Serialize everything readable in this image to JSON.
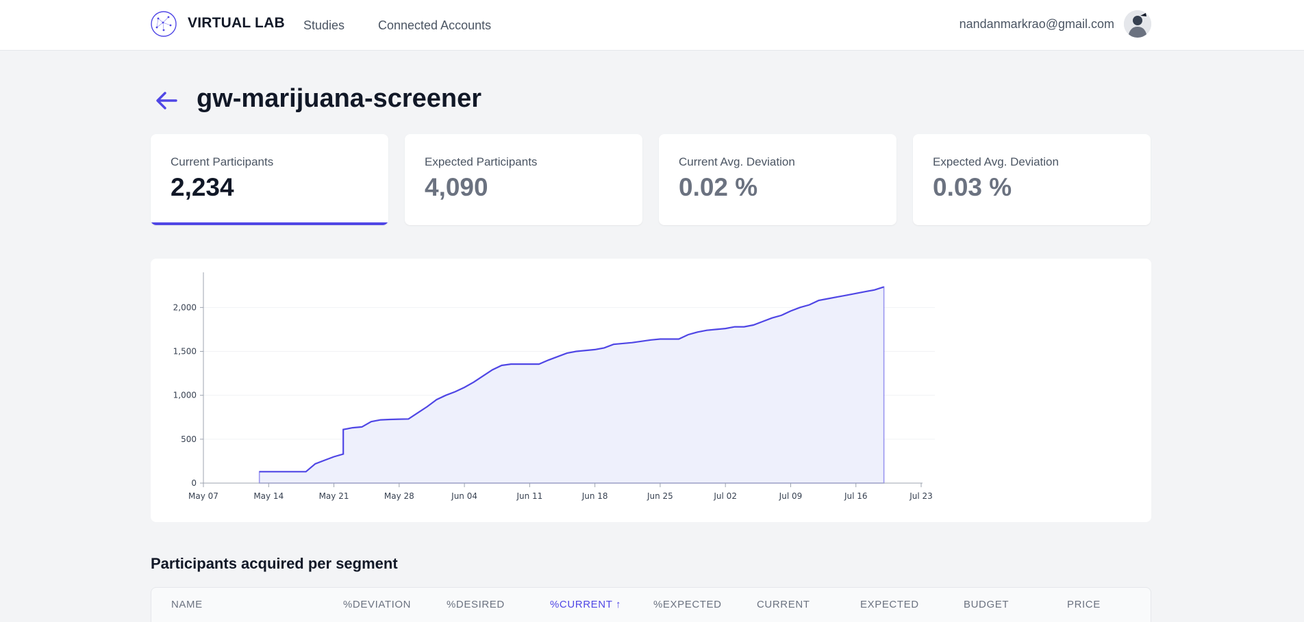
{
  "nav": {
    "brand": "VIRTUAL LAB",
    "links": [
      "Studies",
      "Connected Accounts"
    ],
    "user_email": "nandanmarkrao@gmail.com"
  },
  "page": {
    "title": "gw-marijuana-screener"
  },
  "stats": [
    {
      "label": "Current Participants",
      "value": "2,234"
    },
    {
      "label": "Expected Participants",
      "value": "4,090"
    },
    {
      "label": "Current Avg. Deviation",
      "value": "0.02 %"
    },
    {
      "label": "Expected Avg. Deviation",
      "value": "0.03 %"
    }
  ],
  "colors": {
    "accent": "#4f46e5",
    "area_fill": "#eef0fc",
    "background": "#f3f4f6"
  },
  "chart_data": {
    "type": "area",
    "title": "",
    "xlabel": "",
    "ylabel": "",
    "ylim": [
      0,
      2400
    ],
    "xlim": [
      "2023-05-07",
      "2023-07-23"
    ],
    "y_ticks": [
      "0",
      "500",
      "1,000",
      "1,500",
      "2,000"
    ],
    "y_tick_values": [
      0,
      500,
      1000,
      1500,
      2000
    ],
    "x_ticks": [
      "May 07",
      "May 14",
      "May 21",
      "May 28",
      "Jun 04",
      "Jun 11",
      "Jun 18",
      "Jun 25",
      "Jul 02",
      "Jul 09",
      "Jul 16",
      "Jul 23"
    ],
    "x_tick_dates": [
      "2023-05-07",
      "2023-05-14",
      "2023-05-21",
      "2023-05-28",
      "2023-06-04",
      "2023-06-11",
      "2023-06-18",
      "2023-06-25",
      "2023-07-02",
      "2023-07-09",
      "2023-07-16",
      "2023-07-23"
    ],
    "grid": "horizontal",
    "series": [
      {
        "x": [
          "2023-05-13",
          "2023-05-18",
          "2023-05-19",
          "2023-05-20",
          "2023-05-21",
          "2023-05-22",
          "2023-05-22",
          "2023-05-23",
          "2023-05-24",
          "2023-05-25",
          "2023-05-26",
          "2023-05-27",
          "2023-05-28",
          "2023-05-29",
          "2023-05-30",
          "2023-05-31",
          "2023-06-01",
          "2023-06-02",
          "2023-06-03",
          "2023-06-04",
          "2023-06-05",
          "2023-06-06",
          "2023-06-07",
          "2023-06-08",
          "2023-06-09",
          "2023-06-10",
          "2023-06-12",
          "2023-06-13",
          "2023-06-14",
          "2023-06-15",
          "2023-06-16",
          "2023-06-18",
          "2023-06-19",
          "2023-06-20",
          "2023-06-22",
          "2023-06-24",
          "2023-06-25",
          "2023-06-26",
          "2023-06-27",
          "2023-06-28",
          "2023-06-29",
          "2023-06-30",
          "2023-07-01",
          "2023-07-02",
          "2023-07-03",
          "2023-07-04",
          "2023-07-05",
          "2023-07-06",
          "2023-07-07",
          "2023-07-08",
          "2023-07-09",
          "2023-07-10",
          "2023-07-11",
          "2023-07-12",
          "2023-07-13",
          "2023-07-14",
          "2023-07-15",
          "2023-07-16",
          "2023-07-17",
          "2023-07-18",
          "2023-07-19"
        ],
        "y": [
          130,
          130,
          220,
          260,
          300,
          330,
          610,
          630,
          640,
          700,
          720,
          725,
          728,
          730,
          800,
          870,
          950,
          1000,
          1040,
          1090,
          1150,
          1220,
          1290,
          1340,
          1355,
          1355,
          1355,
          1400,
          1440,
          1480,
          1500,
          1520,
          1540,
          1580,
          1600,
          1630,
          1640,
          1640,
          1640,
          1690,
          1720,
          1740,
          1750,
          1760,
          1780,
          1780,
          1800,
          1840,
          1880,
          1910,
          1960,
          2000,
          2030,
          2080,
          2100,
          2120,
          2140,
          2160,
          2180,
          2200,
          2234
        ]
      }
    ]
  },
  "segment_table": {
    "title": "Participants acquired per segment",
    "columns": [
      "NAME",
      "%DEVIATION",
      "%DESIRED",
      "%CURRENT",
      "%EXPECTED",
      "CURRENT",
      "EXPECTED",
      "BUDGET",
      "PRICE"
    ],
    "sorted_column": "%CURRENT",
    "sort_direction": "ascending"
  }
}
